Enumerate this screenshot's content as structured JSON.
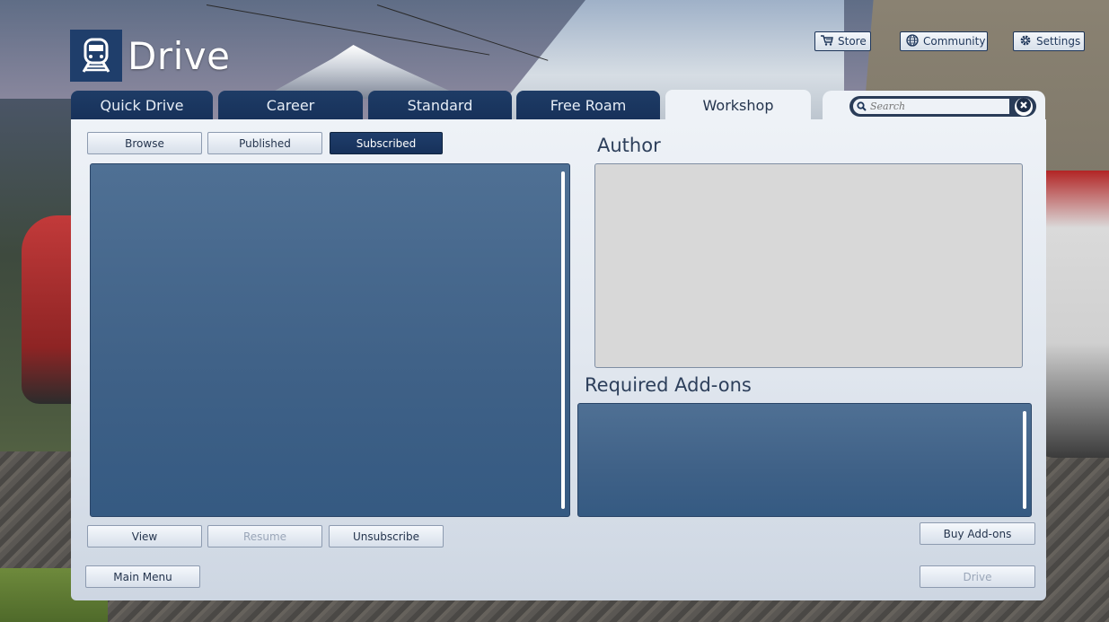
{
  "app": {
    "title": "Drive"
  },
  "top_buttons": {
    "store": "Store",
    "community": "Community",
    "settings": "Settings"
  },
  "tabs": [
    {
      "label": "Quick Drive",
      "active": false
    },
    {
      "label": "Career",
      "active": false
    },
    {
      "label": "Standard",
      "active": false
    },
    {
      "label": "Free Roam",
      "active": false
    },
    {
      "label": "Workshop",
      "active": true
    }
  ],
  "search": {
    "placeholder": "Search",
    "value": ""
  },
  "filters": {
    "browse": "Browse",
    "published": "Published",
    "subscribed": "Subscribed",
    "selected": "Subscribed"
  },
  "sections": {
    "author": "Author",
    "required_addons": "Required Add-ons"
  },
  "actions": {
    "view": "View",
    "resume": "Resume",
    "unsubscribe": "Unsubscribe",
    "buy_addons": "Buy Add-ons",
    "main_menu": "Main Menu",
    "drive": "Drive"
  },
  "colors": {
    "navy": "#1f3e6b",
    "panel": "#eef2f7",
    "list_blue": "#436589",
    "author_box": "#d8d8d8"
  }
}
